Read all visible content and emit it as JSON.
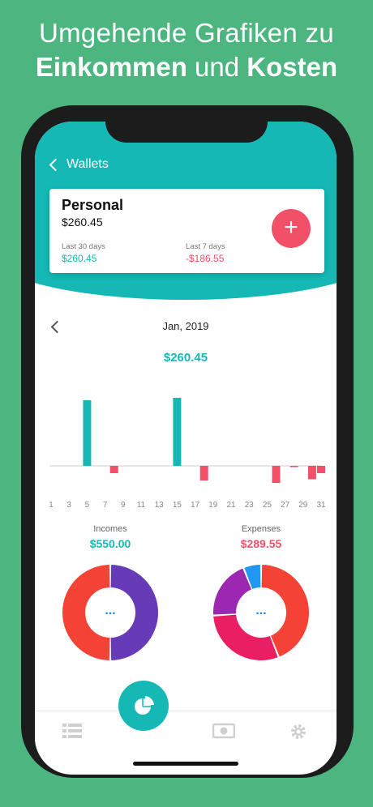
{
  "headline": {
    "line1": "Umgehende Grafiken zu",
    "bold1": "Einkommen",
    "mid": " und ",
    "bold2": "Kosten"
  },
  "nav": {
    "back_label": "Wallets"
  },
  "wallet": {
    "name": "Personal",
    "balance": "$260.45",
    "last30_label": "Last 30 days",
    "last30_value": "$260.45",
    "last7_label": "Last 7 days",
    "last7_value": "-$186.55"
  },
  "month": {
    "label": "Jan, 2019",
    "total": "$260.45"
  },
  "chart_data": {
    "type": "bar",
    "x_ticks": [
      "1",
      "3",
      "5",
      "7",
      "9",
      "11",
      "13",
      "15",
      "17",
      "19",
      "21",
      "23",
      "25",
      "27",
      "29",
      "31"
    ],
    "days": [
      1,
      2,
      3,
      4,
      5,
      6,
      7,
      8,
      9,
      10,
      11,
      12,
      13,
      14,
      15,
      16,
      17,
      18,
      19,
      20,
      21,
      22,
      23,
      24,
      25,
      26,
      27,
      28,
      29,
      30,
      31
    ],
    "values": [
      0,
      0,
      0,
      0,
      270,
      0,
      0,
      -30,
      0,
      0,
      0,
      0,
      0,
      0,
      280,
      0,
      0,
      -60,
      0,
      0,
      0,
      0,
      0,
      0,
      0,
      -70,
      0,
      -5,
      0,
      -55,
      -30
    ],
    "colors": {
      "positive": "#15b8b5",
      "negative": "#f25068"
    }
  },
  "incomes": {
    "label": "Incomes",
    "value": "$550.00",
    "color": "#15b8b5",
    "segments": [
      {
        "frac": 0.5,
        "color": "#673ab7"
      },
      {
        "frac": 0.5,
        "color": "#f44336"
      }
    ]
  },
  "expenses": {
    "label": "Expenses",
    "value": "$289.55",
    "color": "#f25068",
    "segments": [
      {
        "frac": 0.44,
        "color": "#f44336"
      },
      {
        "frac": 0.3,
        "color": "#e91e63"
      },
      {
        "frac": 0.2,
        "color": "#9c27b0"
      },
      {
        "frac": 0.06,
        "color": "#2196f3"
      }
    ]
  },
  "donut_center": "...",
  "tabs": [
    {
      "icon": "list-icon"
    },
    {
      "icon": "pie-chart-icon"
    },
    {
      "icon": "money-icon"
    },
    {
      "icon": "gear-icon"
    }
  ]
}
